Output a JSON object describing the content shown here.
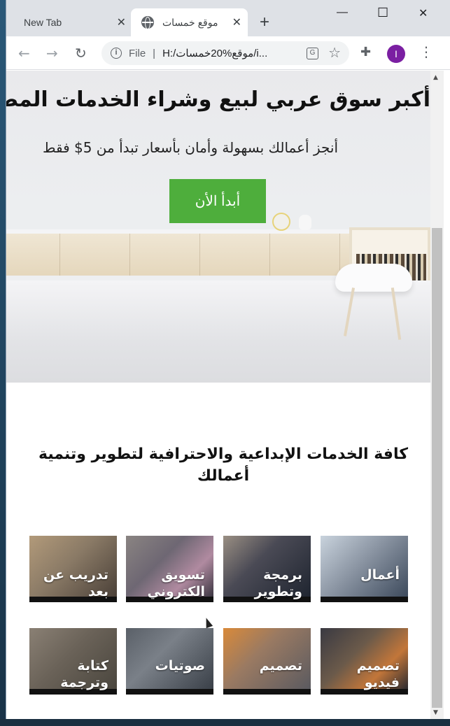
{
  "browser": {
    "tabs": [
      {
        "label": "New Tab",
        "active": false
      },
      {
        "label": "موقع خمسات",
        "active": true
      }
    ],
    "new_tab_symbol": "+",
    "window_controls": {
      "minimize": "—",
      "maximize": "☐",
      "close": "✕"
    },
    "address": {
      "info_icon": "info-icon",
      "scheme_label": "File",
      "separator": "|",
      "url": "H:/موقع%20خمسات/i..."
    },
    "profile_initial": "I",
    "menu_symbol": "⋮"
  },
  "hero": {
    "title": "أكبر سوق عربي لبيع وشراء الخدمات المصغرة",
    "subtitle": "أنجز أعمالك بسهولة وأمان بأسعار تبدأ من 5$ فقط",
    "cta_label": "أبدأ الأن",
    "cta_color": "#4eae3c"
  },
  "services": {
    "title": "كافة الخدمات الإبداعية والاحترافية لتطوير وتنمية أعمالك",
    "cards": [
      {
        "label": "أعمال"
      },
      {
        "label": "برمجة وتطوير"
      },
      {
        "label": "تسويق الكتروني"
      },
      {
        "label": "تدريب عن بعد"
      },
      {
        "label": "تصميم فيديو"
      },
      {
        "label": "تصميم"
      },
      {
        "label": "صوتيات"
      },
      {
        "label": "كتابة وترجمة"
      }
    ]
  }
}
